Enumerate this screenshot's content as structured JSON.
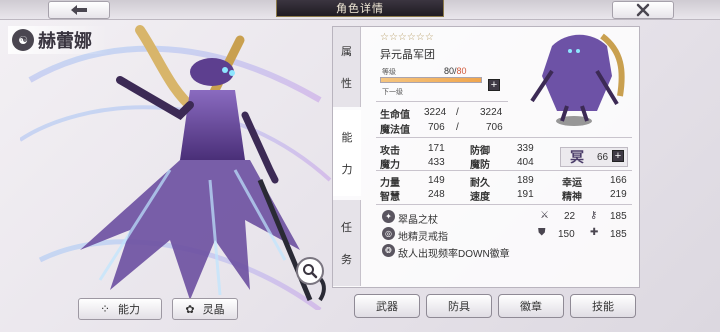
{
  "header": {
    "title": "角色详情"
  },
  "character": {
    "name": "赫蕾娜",
    "stars": "☆☆☆☆☆☆",
    "faction": "异元晶军团"
  },
  "level": {
    "label": "等级",
    "current": "80",
    "separator": "/",
    "max": "80",
    "progress": 1.0,
    "next_label": "下一级"
  },
  "tabs": {
    "attributes": [
      "属",
      "性"
    ],
    "abilities": [
      "能",
      "力"
    ],
    "missions": [
      "任",
      "务"
    ]
  },
  "vitals": [
    {
      "label": "生命值",
      "current": "3224",
      "max": "3224"
    },
    {
      "label": "魔法值",
      "current": "706",
      "max": "706"
    }
  ],
  "stats": [
    {
      "label": "攻击",
      "value": "171"
    },
    {
      "label": "防御",
      "value": "339"
    },
    {
      "label": "魔力",
      "value": "433"
    },
    {
      "label": "魔防",
      "value": "404"
    },
    {
      "label": "力量",
      "value": "149"
    },
    {
      "label": "耐久",
      "value": "189"
    },
    {
      "label": "智慧",
      "value": "248"
    },
    {
      "label": "速度",
      "value": "191"
    },
    {
      "label": "幸运",
      "value": "166"
    },
    {
      "label": "精神",
      "value": "219"
    }
  ],
  "rank": {
    "icon_text": "冥",
    "value": "66"
  },
  "equipment": [
    {
      "name": "翠晶之杖",
      "stat1_icon": "sword-icon",
      "stat1": "22",
      "stat2_icon": "key-icon",
      "stat2": "185"
    },
    {
      "name": "地精灵戒指",
      "stat1_icon": "shield-icon",
      "stat1": "150",
      "stat2_icon": "cross-icon",
      "stat2": "185"
    },
    {
      "name": "敌人出现频率DOWN徽章"
    }
  ],
  "bottom_left": {
    "ability_label": "能力",
    "crystal_label": "灵晶"
  },
  "bottom_right": [
    "武器",
    "防具",
    "徽章",
    "技能"
  ],
  "colors": {
    "level_max": "#d1583a",
    "accent_purple": "#6b4fa0",
    "panel_bg": "#ffffff"
  }
}
